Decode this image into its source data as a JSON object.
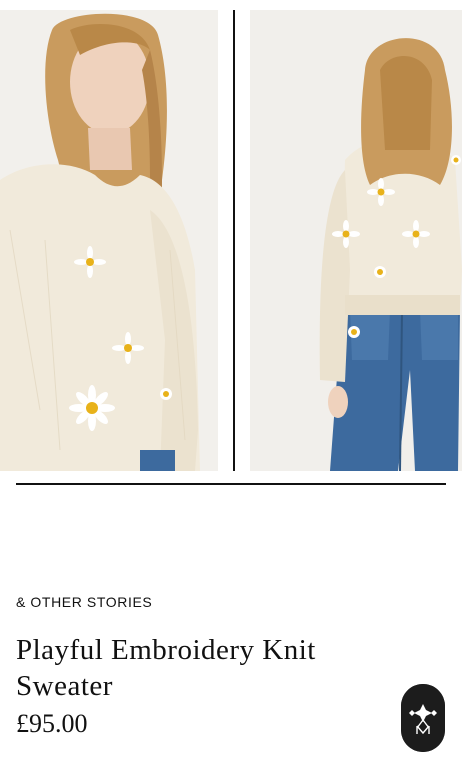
{
  "gallery": {
    "images": [
      {
        "description": "front view"
      },
      {
        "description": "back view"
      }
    ]
  },
  "product": {
    "brand": "& OTHER STORIES",
    "title": "Playful Embroidery Knit Sweater",
    "price": "£95.00"
  },
  "assistant": {
    "icon": "monogram-logo-icon"
  },
  "colors": {
    "text": "#111111",
    "sweater": "#f1eadb",
    "daisy_center": "#e8b21a",
    "denim": "#3d6a9e",
    "button": "#1c1c1c"
  }
}
